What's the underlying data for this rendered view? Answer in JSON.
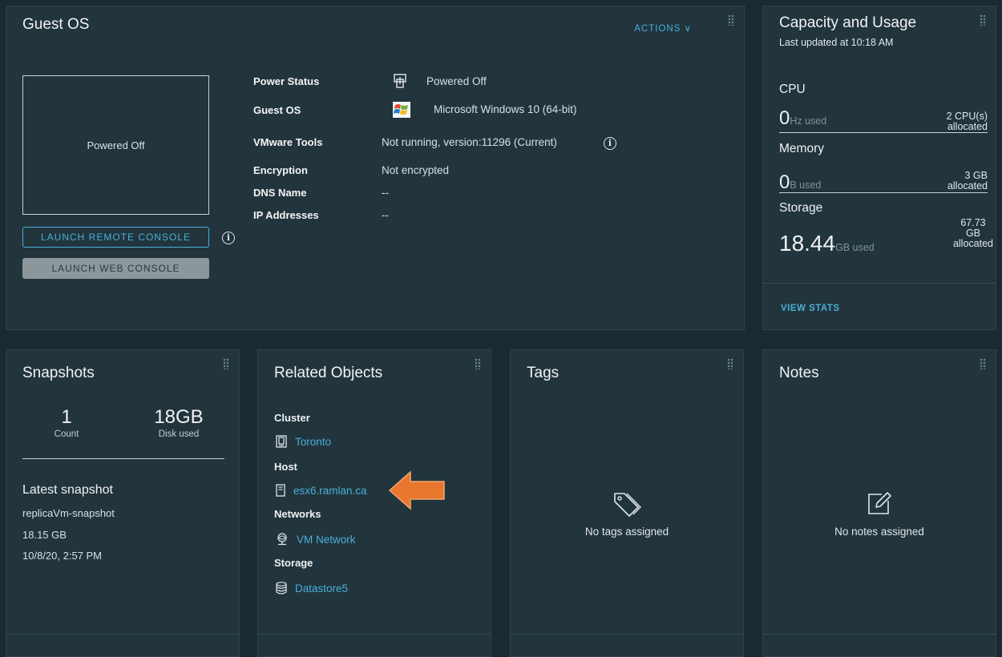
{
  "guest_os": {
    "title": "Guest OS",
    "actions_label": "ACTIONS ∨",
    "console_status": "Powered Off",
    "launch_remote_label": "LAUNCH REMOTE CONSOLE",
    "launch_web_label": "LAUNCH WEB CONSOLE",
    "properties": [
      {
        "label": "Power Status",
        "value": "Powered Off",
        "icon": "power-status-icon"
      },
      {
        "label": "Guest OS",
        "value": "Microsoft Windows 10 (64-bit)",
        "icon": "windows-logo-icon"
      },
      {
        "label": "VMware Tools",
        "value": "Not running, version:11296 (Current)",
        "icon": "info-icon"
      },
      {
        "label": "Encryption",
        "value": "Not encrypted"
      },
      {
        "label": "DNS Name",
        "value": "--"
      },
      {
        "label": "IP Addresses",
        "value": "--"
      }
    ]
  },
  "capacity": {
    "title": "Capacity and Usage",
    "subtitle": "Last updated at 10:18 AM",
    "cpu": {
      "label": "CPU",
      "value": "0",
      "unit": "Hz used",
      "alloc_1": "2 CPU(s)",
      "alloc_2": "allocated"
    },
    "memory": {
      "label": "Memory",
      "value": "0",
      "unit": "B used",
      "alloc_1": "3 GB",
      "alloc_2": "allocated"
    },
    "storage": {
      "label": "Storage",
      "value": "18.44",
      "unit": "GB used",
      "alloc_1": "67.73",
      "alloc_2": "GB",
      "alloc_3": "allocated"
    },
    "view_stats": "VIEW STATS"
  },
  "snapshots": {
    "title": "Snapshots",
    "count": "1",
    "count_label": "Count",
    "disk": "18GB",
    "disk_label": "Disk used",
    "latest_title": "Latest snapshot",
    "latest_name": "replicaVm-snapshot",
    "latest_size": "18.15 GB",
    "latest_date": "10/8/20, 2:57 PM"
  },
  "related": {
    "title": "Related Objects",
    "cluster_head": "Cluster",
    "cluster": "Toronto",
    "host_head": "Host",
    "host": "esx6.ramlan.ca",
    "networks_head": "Networks",
    "network": "VM Network",
    "storage_head": "Storage",
    "datastore": "Datastore5"
  },
  "tags": {
    "title": "Tags",
    "empty": "No tags assigned"
  },
  "notes": {
    "title": "Notes",
    "empty": "No notes assigned"
  },
  "colors": {
    "accent": "#49afd9",
    "annotation_arrow": "#e8772e",
    "panel": "#22343c",
    "background": "#1b2a32"
  }
}
